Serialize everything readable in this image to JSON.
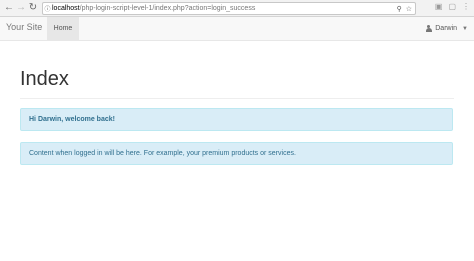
{
  "browser": {
    "url_host": "localhost",
    "url_path": "/php-login-script-level-1/index.php?action=login_success"
  },
  "navbar": {
    "brand": "Your Site",
    "home_label": "Home",
    "user_name": "Darwin"
  },
  "main": {
    "title": "Index",
    "welcome_message": "Hi Darwin, welcome back!",
    "content_message": "Content when logged in will be here. For example, your premium products or services."
  },
  "colors": {
    "alert_bg": "#d9edf7",
    "alert_text": "#31708f",
    "navbar_bg": "#f8f8f8"
  }
}
